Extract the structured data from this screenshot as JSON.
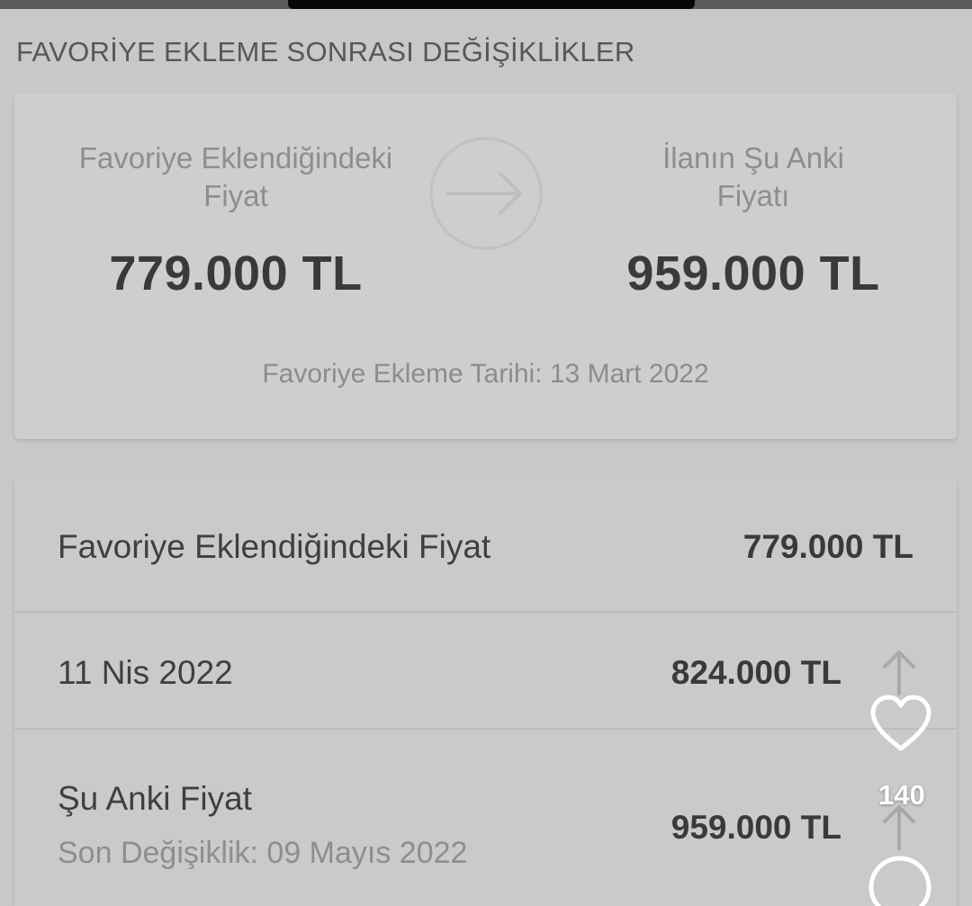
{
  "section": {
    "title": "FAVORİYE EKLEME SONRASI DEĞİŞİKLİKLER"
  },
  "summary": {
    "left_label": "Favoriye Eklendiğindeki\nFiyat",
    "left_price": "779.000 TL",
    "right_label": "İlanın Şu Anki\nFiyatı",
    "right_price": "959.000 TL",
    "arrow_icon": "arrow-right-icon",
    "added_date": "Favoriye Ekleme Tarihi: 13 Mart 2022"
  },
  "history": {
    "rows": [
      {
        "label": "Favoriye Eklendiğindeki Fiyat",
        "value": "779.000 TL"
      },
      {
        "label": "11 Nis 2022",
        "value": "824.000 TL",
        "trend_icon": "arrow-up-icon"
      },
      {
        "label": "Şu Anki Fiyat",
        "sub": "Son Değişiklik: 09 Mayıs 2022",
        "value": "959.000 TL",
        "trend_icon": "arrow-up-icon"
      }
    ]
  },
  "overlay": {
    "like_icon": "heart-icon",
    "like_count": "140",
    "comment_icon": "comment-icon"
  },
  "colors": {
    "background": "#c9c7c9",
    "card": "#cfcdcf",
    "price_text": "#3a393b",
    "muted_text": "#8f8d8f",
    "overlay_icon": "#ffffff"
  }
}
